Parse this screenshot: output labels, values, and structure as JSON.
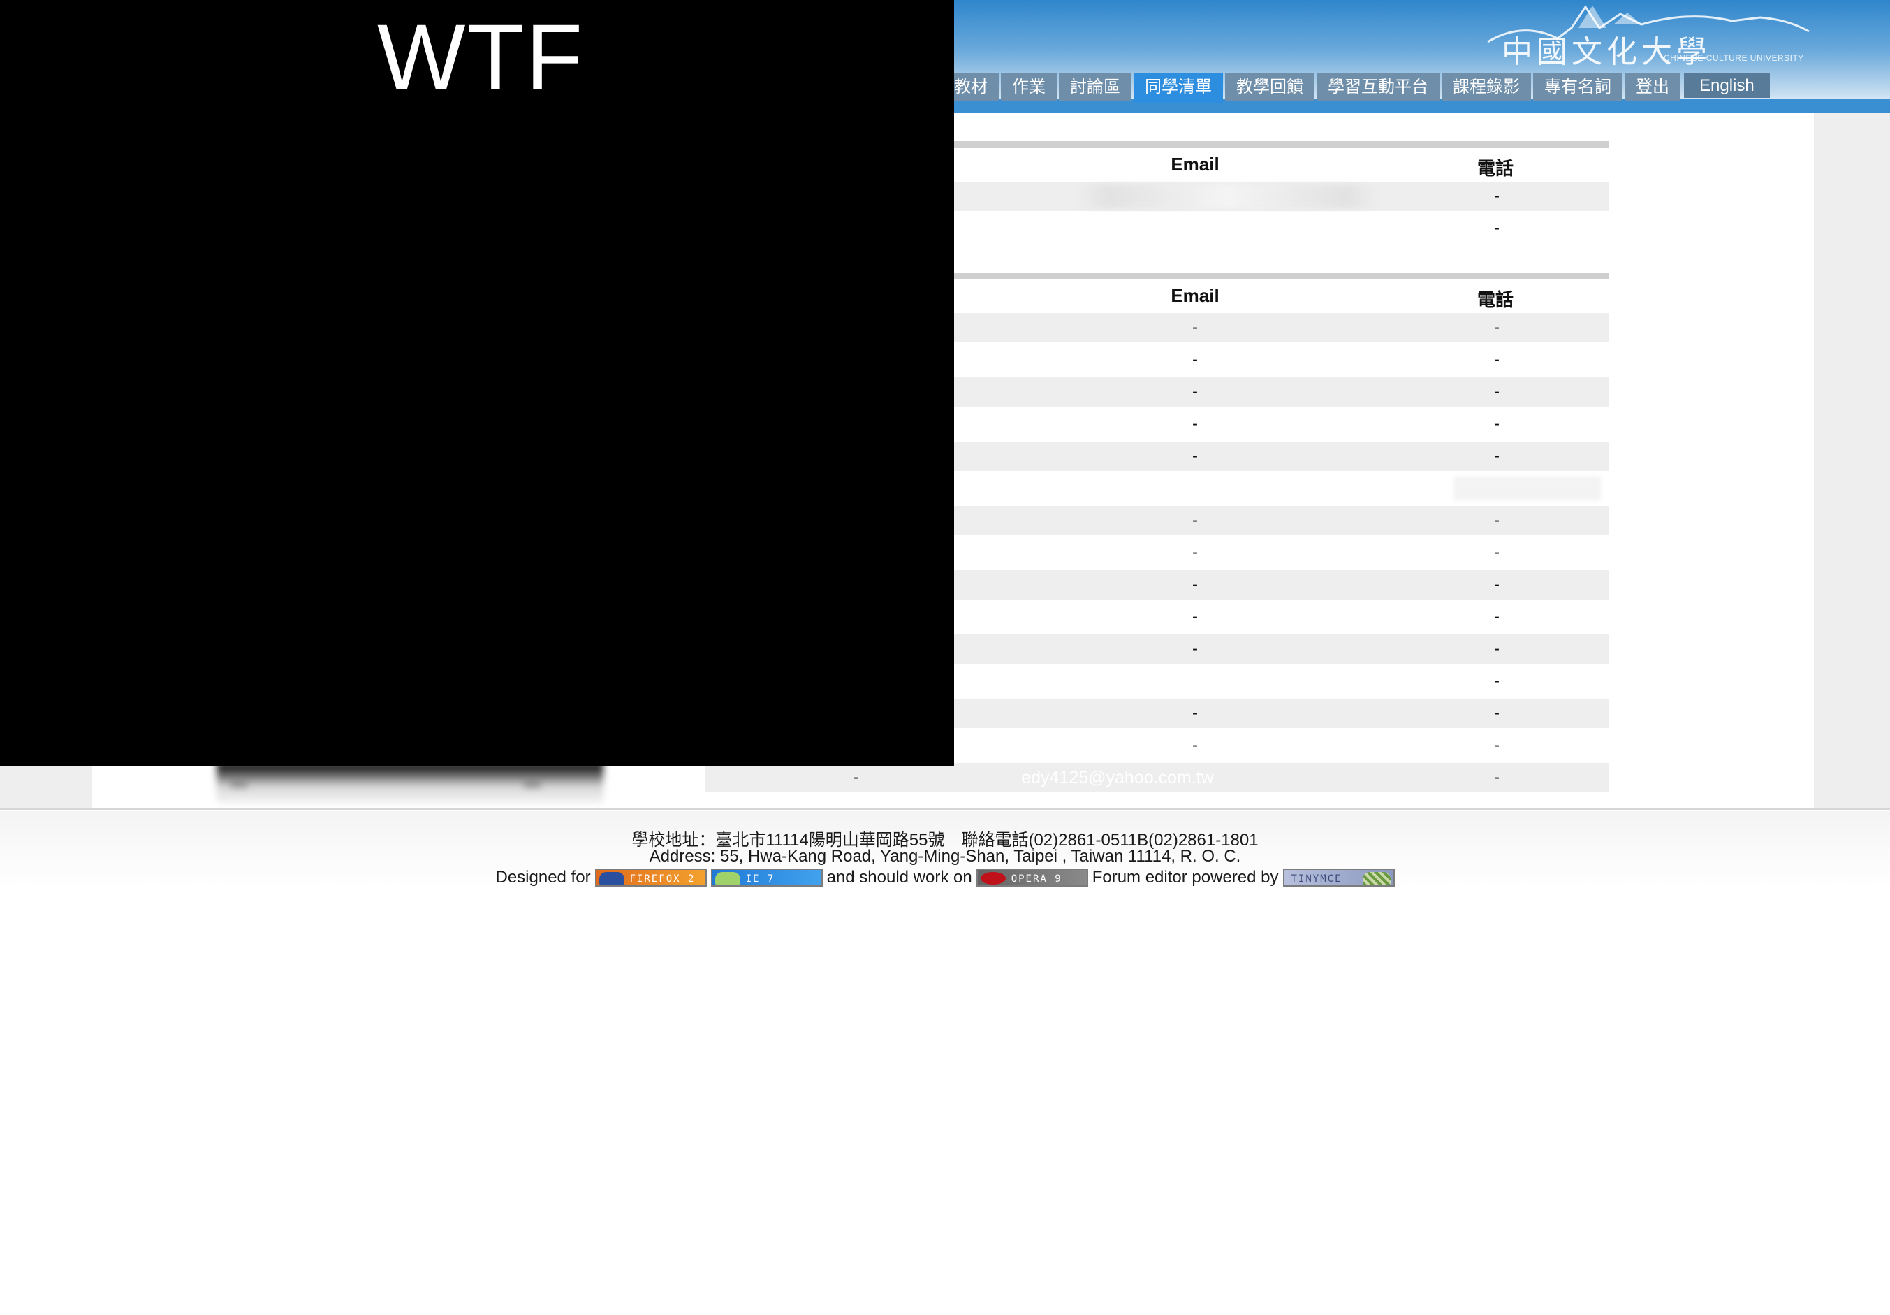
{
  "overlay": {
    "text": "WTF"
  },
  "header": {
    "logo": {
      "chinese": "中國文化大學",
      "english": "CHINESE CULTURE UNIVERSITY"
    },
    "tabs": [
      {
        "label": "教材",
        "active": false
      },
      {
        "label": "作業",
        "active": false
      },
      {
        "label": "討論區",
        "active": false
      },
      {
        "label": "同學清單",
        "active": true
      },
      {
        "label": "教學回饋",
        "active": false
      },
      {
        "label": "學習互動平台",
        "active": false
      },
      {
        "label": "課程錄影",
        "active": false
      },
      {
        "label": "專有名詞",
        "active": false
      },
      {
        "label": "登出",
        "active": false
      },
      {
        "label": "English",
        "active": false
      }
    ]
  },
  "tables": {
    "table1": {
      "headers": {
        "email": "Email",
        "phone": "電話"
      },
      "rows": [
        {
          "email": "",
          "phone": "-"
        },
        {
          "email": "",
          "phone": "-"
        }
      ]
    },
    "table2": {
      "headers": {
        "email": "Email",
        "phone": "電話"
      },
      "rows": [
        {
          "email": "-",
          "phone": "-"
        },
        {
          "email": "-",
          "phone": "-"
        },
        {
          "email": "-",
          "phone": "-"
        },
        {
          "email": "-",
          "phone": "-"
        },
        {
          "email": "-",
          "phone": "-"
        },
        {
          "email": "",
          "phone": ""
        },
        {
          "email": "-",
          "phone": "-"
        },
        {
          "email": "-",
          "phone": "-"
        },
        {
          "email": "-",
          "phone": "-"
        },
        {
          "email": "-",
          "phone": "-"
        },
        {
          "email": "-",
          "phone": "-"
        },
        {
          "email": "",
          "phone": "-"
        },
        {
          "email": "-",
          "phone": "-"
        },
        {
          "email": "-",
          "phone": "-"
        },
        {
          "col": "-",
          "email": "edy4125@yahoo.com.tw",
          "phone": "-"
        }
      ]
    }
  },
  "footer": {
    "address_zh": "學校地址：臺北市11114陽明山華岡路55號　聯絡電話(02)2861-0511B(02)2861-1801",
    "address_en": "Address: 55, Hwa-Kang Road, Yang-Ming-Shan, Taipei , Taiwan 11114, R. O. C.",
    "designed_for": "Designed for",
    "should_work_on": "and should work on",
    "forum_editor": "Forum editor powered by",
    "badges": {
      "firefox": "FIREFOX 2",
      "ie": "IE 7",
      "opera": "OPERA 9",
      "tinymce": "TINYMCE"
    }
  }
}
